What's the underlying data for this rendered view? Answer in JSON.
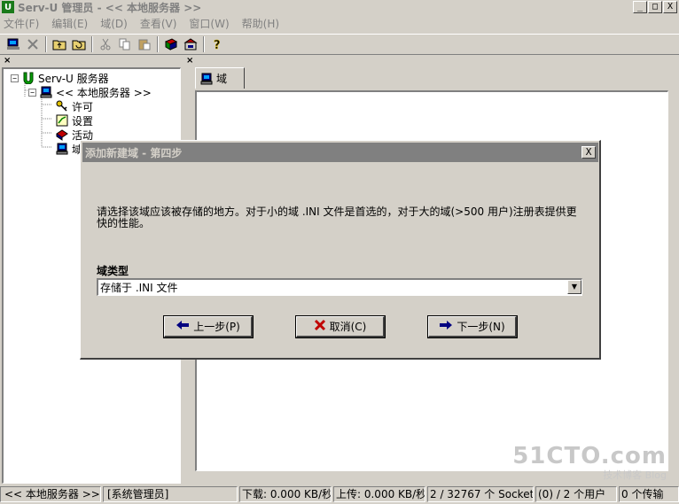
{
  "window": {
    "title": "Serv-U 管理员 - << 本地服务器 >>",
    "min_label": "_",
    "max_label": "□",
    "close_label": "X"
  },
  "menu": {
    "items": [
      "文件(F)",
      "编辑(E)",
      "域(D)",
      "查看(V)",
      "窗口(W)",
      "帮助(H)"
    ]
  },
  "toolbar": {
    "icons": [
      "connect-icon",
      "delete-icon",
      "up-folder-icon",
      "refresh-icon",
      "cut-icon",
      "copy-icon",
      "paste-icon",
      "book-icon",
      "server-icon",
      "help-icon"
    ]
  },
  "tree": {
    "items": [
      {
        "label": "Serv-U 服务器",
        "level": 0
      },
      {
        "label": "<< 本地服务器 >>",
        "level": 1
      },
      {
        "label": "许可",
        "level": 2
      },
      {
        "label": "设置",
        "level": 2
      },
      {
        "label": "活动",
        "level": 2
      },
      {
        "label": "域",
        "level": 2
      }
    ]
  },
  "right_pane": {
    "tab_label": "域"
  },
  "dialog": {
    "title": "添加新建域 - 第四步",
    "close_label": "X",
    "description": "请选择该域应该被存储的地方。对于小的域 .INI 文件是首选的，对于大的域(>500 用户)注册表提供更快的性能。",
    "field_label": "域类型",
    "selected_value": "存储于 .INI 文件",
    "buttons": {
      "back": "上一步(P)",
      "cancel": "取消(C)",
      "next": "下一步(N)"
    }
  },
  "statusbar": {
    "server": "<< 本地服务器 >>",
    "user": "[系统管理员]",
    "download": "下载: 0.000 KB/秒",
    "upload": "上传: 0.000 KB/秒",
    "sockets": "2 / 32767 个 Socket",
    "users": "(0) / 2 个用户",
    "transfers": "0 个传输"
  },
  "watermark": {
    "brand": "51CTO.com",
    "tagline": "技术博客 Blog"
  },
  "colors": {
    "face": "#d4d0c8",
    "inactive_title": "#808080",
    "content": "#ffffff"
  }
}
